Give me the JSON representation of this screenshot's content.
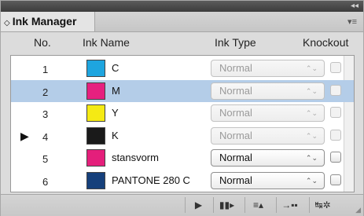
{
  "panel": {
    "tab_title": "Ink Manager",
    "tab_arrows": "◇",
    "collapse_glyph": "◂◂",
    "menu_glyph": "▾≡"
  },
  "columns": {
    "no": "No.",
    "name": "Ink Name",
    "type": "Ink Type",
    "knockout": "Knockout"
  },
  "inks": [
    {
      "no": "1",
      "name": "C",
      "color": "#1ea5df",
      "type": "Normal",
      "enabled": false,
      "selected": false,
      "target": false
    },
    {
      "no": "2",
      "name": "M",
      "color": "#e6207f",
      "type": "Normal",
      "enabled": false,
      "selected": true,
      "target": false
    },
    {
      "no": "3",
      "name": "Y",
      "color": "#f5ea14",
      "type": "Normal",
      "enabled": false,
      "selected": false,
      "target": false
    },
    {
      "no": "4",
      "name": "K",
      "color": "#1a1a1a",
      "type": "Normal",
      "enabled": false,
      "selected": false,
      "target": true
    },
    {
      "no": "5",
      "name": "stansvorm",
      "color": "#e41f7b",
      "type": "Normal",
      "enabled": true,
      "selected": false,
      "target": false
    },
    {
      "no": "6",
      "name": "PANTONE 280 C",
      "color": "#16407b",
      "type": "Normal",
      "enabled": true,
      "selected": false,
      "target": false
    }
  ],
  "icons": {
    "target": "target-ink-icon",
    "select_arrows": "⌃⌄"
  },
  "toolbar": {
    "target_label": "▶",
    "tool2": "▮▮▸",
    "tool3": "≡▴",
    "tool4": "→▪▪",
    "tool5": "↹✲"
  }
}
